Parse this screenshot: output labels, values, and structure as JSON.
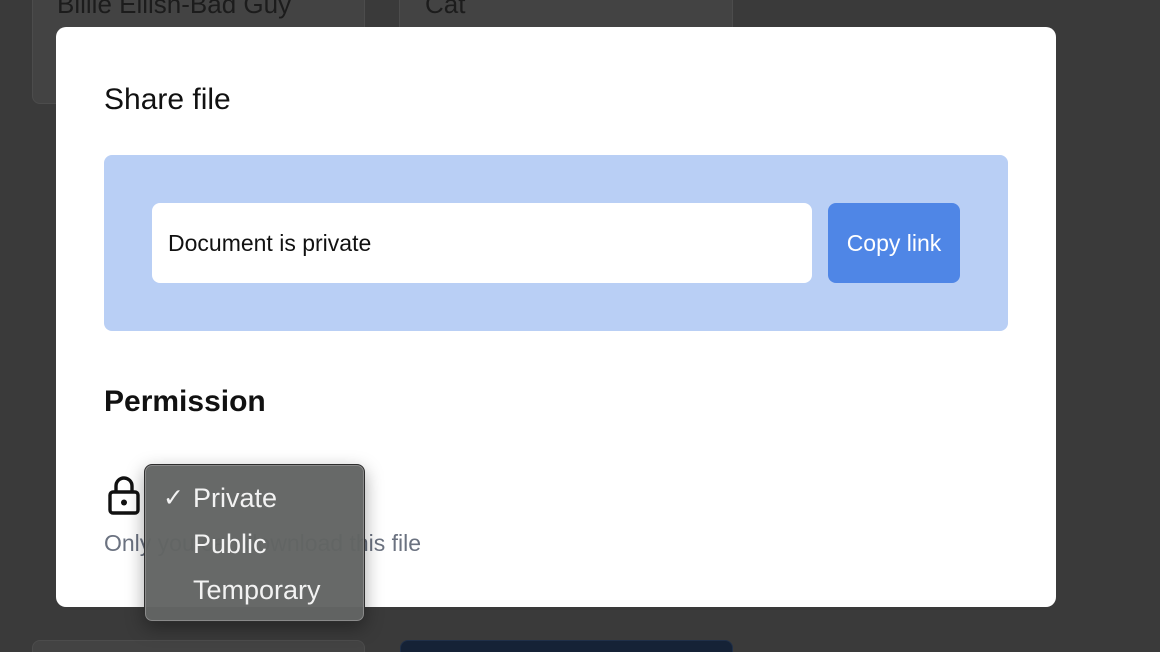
{
  "background": {
    "cards": [
      {
        "title": "Billie Eilish-Bad Guy"
      },
      {
        "title": "Cat"
      }
    ]
  },
  "modal": {
    "title": "Share file",
    "link_field": {
      "value": "Document is private"
    },
    "copy_button_label": "Copy link",
    "permission": {
      "section_title": "Permission",
      "icon": "lock-icon",
      "description": "Only you can download this file"
    }
  },
  "permission_menu": {
    "selected": "Private",
    "options": [
      "Private",
      "Public",
      "Temporary"
    ],
    "check_glyph": "✓"
  },
  "colors": {
    "accent": "#4f86e6",
    "panel": "#b9cff5",
    "overlay": "#3a3a3a"
  }
}
